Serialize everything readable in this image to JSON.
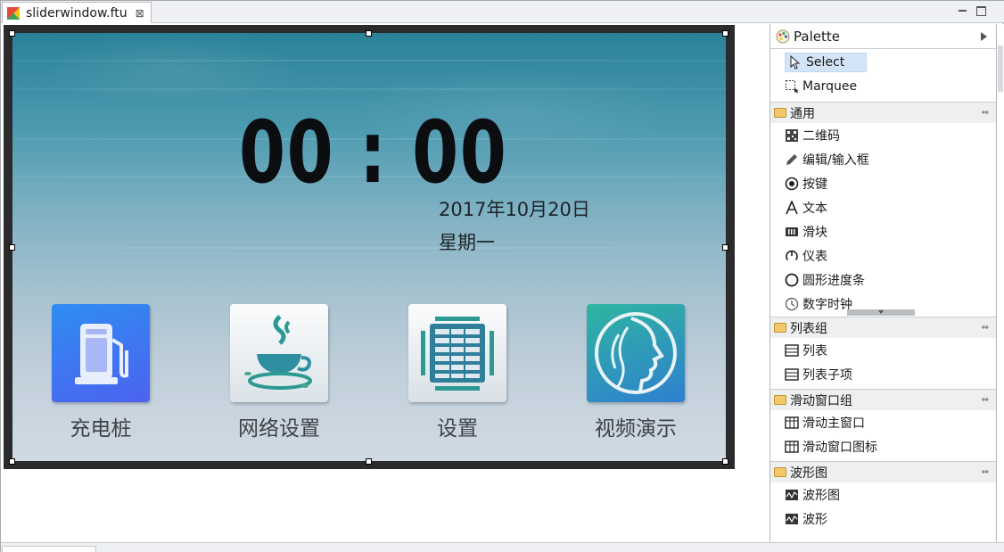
{
  "editor_tab": {
    "title": "sliderwindow.ftu",
    "close_symbol": "⊠"
  },
  "screen": {
    "clock": "00 : 00",
    "date": "2017年10月20日",
    "weekday": "星期一",
    "apps": [
      {
        "label": "充电桩",
        "icon": "fuel-pump-icon"
      },
      {
        "label": "网络设置",
        "icon": "coffee-cup-icon"
      },
      {
        "label": "设置",
        "icon": "settings-grid-icon"
      },
      {
        "label": "视频演示",
        "icon": "face-profile-icon"
      }
    ]
  },
  "palette": {
    "title": "Palette",
    "tools": [
      {
        "label": "Select",
        "icon": "cursor-arrow-icon"
      },
      {
        "label": "Marquee",
        "icon": "marquee-icon"
      }
    ],
    "drawers": [
      {
        "label": "通用",
        "items": [
          {
            "label": "二维码",
            "icon": "qrcode-icon"
          },
          {
            "label": "编辑/输入框",
            "icon": "pencil-icon"
          },
          {
            "label": "按键",
            "icon": "radio-button-icon"
          },
          {
            "label": "文本",
            "icon": "text-a-icon"
          },
          {
            "label": "滑块",
            "icon": "slider-icon"
          },
          {
            "label": "仪表",
            "icon": "gauge-icon"
          },
          {
            "label": "圆形进度条",
            "icon": "circle-icon"
          },
          {
            "label": "数字时钟",
            "icon": "clock-icon"
          }
        ]
      },
      {
        "label": "列表组",
        "items": [
          {
            "label": "列表",
            "icon": "list-icon"
          },
          {
            "label": "列表子项",
            "icon": "list-icon"
          }
        ]
      },
      {
        "label": "滑动窗口组",
        "items": [
          {
            "label": "滑动主窗口",
            "icon": "grid-window-icon"
          },
          {
            "label": "滑动窗口图标",
            "icon": "grid-window-icon"
          }
        ]
      },
      {
        "label": "波形图",
        "items": [
          {
            "label": "波形图",
            "icon": "waveform-icon"
          },
          {
            "label": "波形",
            "icon": "waveform-icon"
          }
        ]
      }
    ]
  }
}
